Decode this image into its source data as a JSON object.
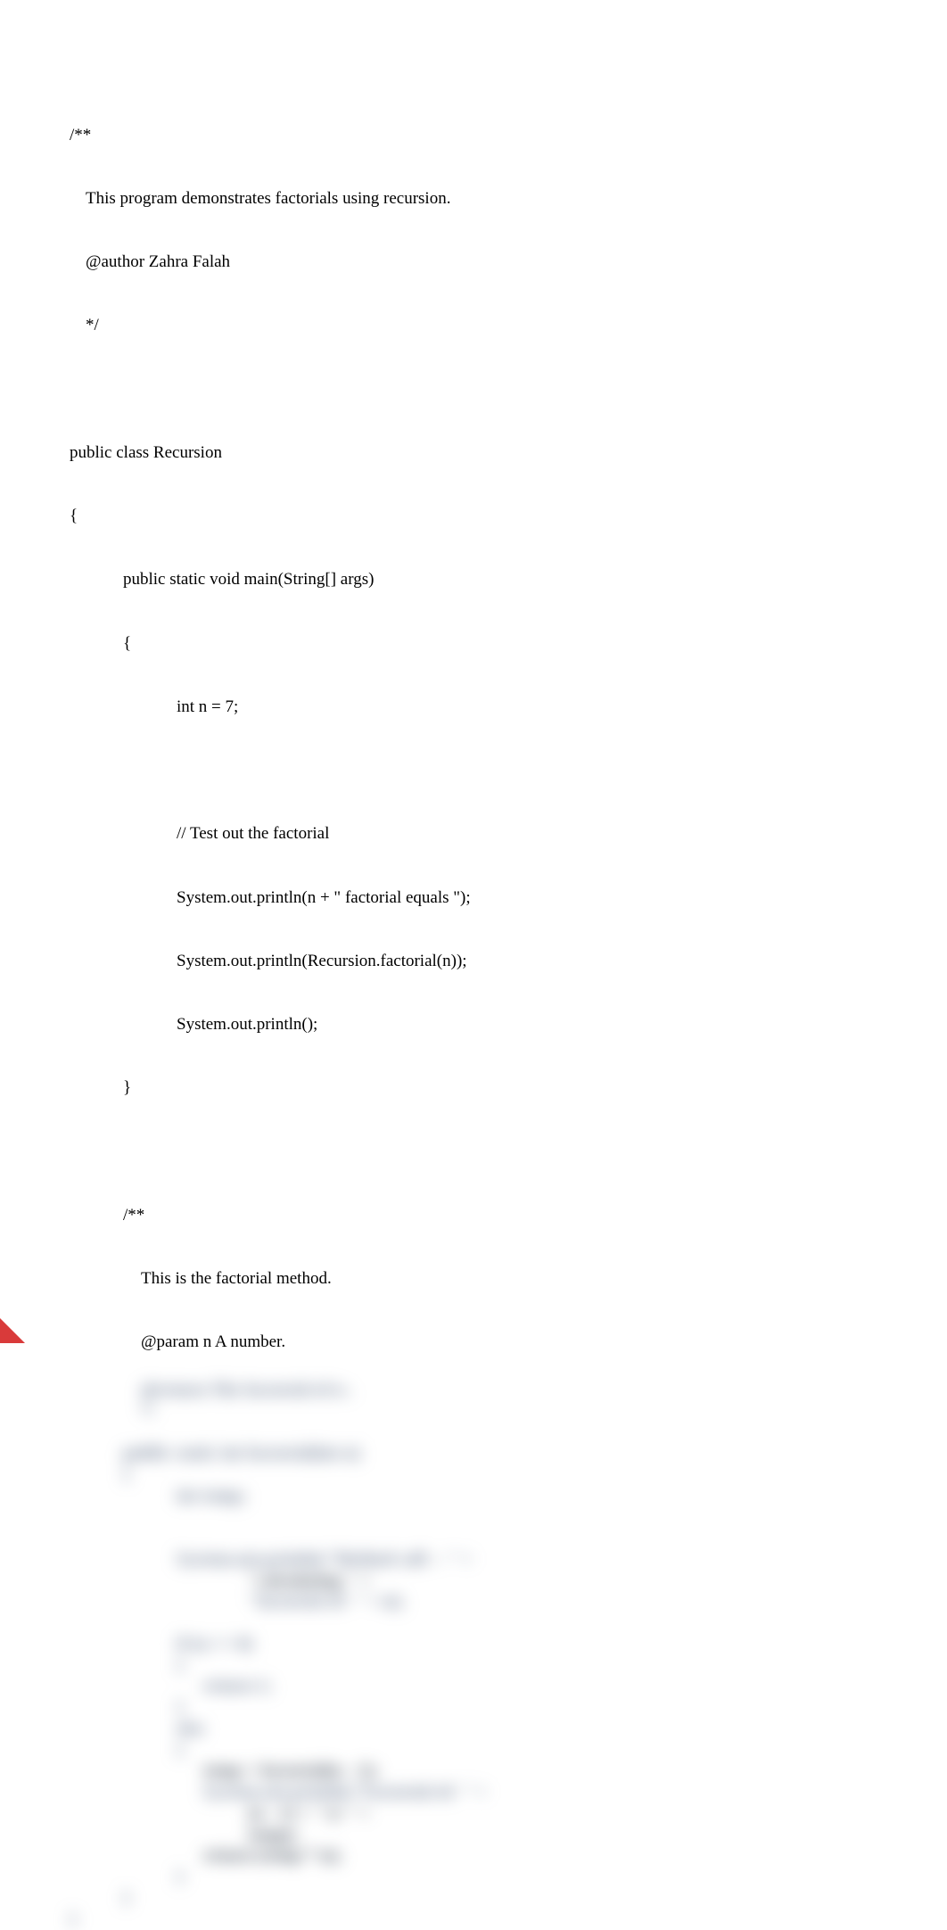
{
  "code": {
    "l01": "/**",
    "l02": "This program demonstrates factorials using recursion.",
    "l03": "@author Zahra Falah",
    "l04": "*/",
    "l05": "",
    "l06": "public class Recursion",
    "l07": "{",
    "l08": "public static void main(String[] args)",
    "l09": "{",
    "l10": "int n = 7;",
    "l11": "",
    "l12": "// Test out the factorial",
    "l13": "System.out.println(n + \" factorial equals \");",
    "l14": "System.out.println(Recursion.factorial(n));",
    "l15": "System.out.println();",
    "l16": "}",
    "l17": "",
    "l18": "/**",
    "l19": "This is the factorial method.",
    "l20": "@param n A number."
  },
  "obscured": {
    "b01": "@return The factorial of n .",
    "b02": "*/",
    "b03": "public static int factorial(int n)",
    "b04": "{",
    "b05": "int temp;",
    "b06": "System.out.println(\"Method call -- \" +",
    "b07": "\"calculating \" +",
    "b08": "\"factorial of: \" + n);",
    "b09": "if (n == 0)",
    "b10": "{",
    "b11": "return 1;",
    "b12": "}",
    "b13": "else",
    "b14": "{",
    "b15": "temp = factorial(n - 1);",
    "b16": "System.out.println(\"Factorial of: \" +",
    "b17": "(n - 1) + \" is \" +",
    "b18": "temp);",
    "b19": "return (temp * n);",
    "b20": "}",
    "b21": "}",
    "b22": "}"
  }
}
